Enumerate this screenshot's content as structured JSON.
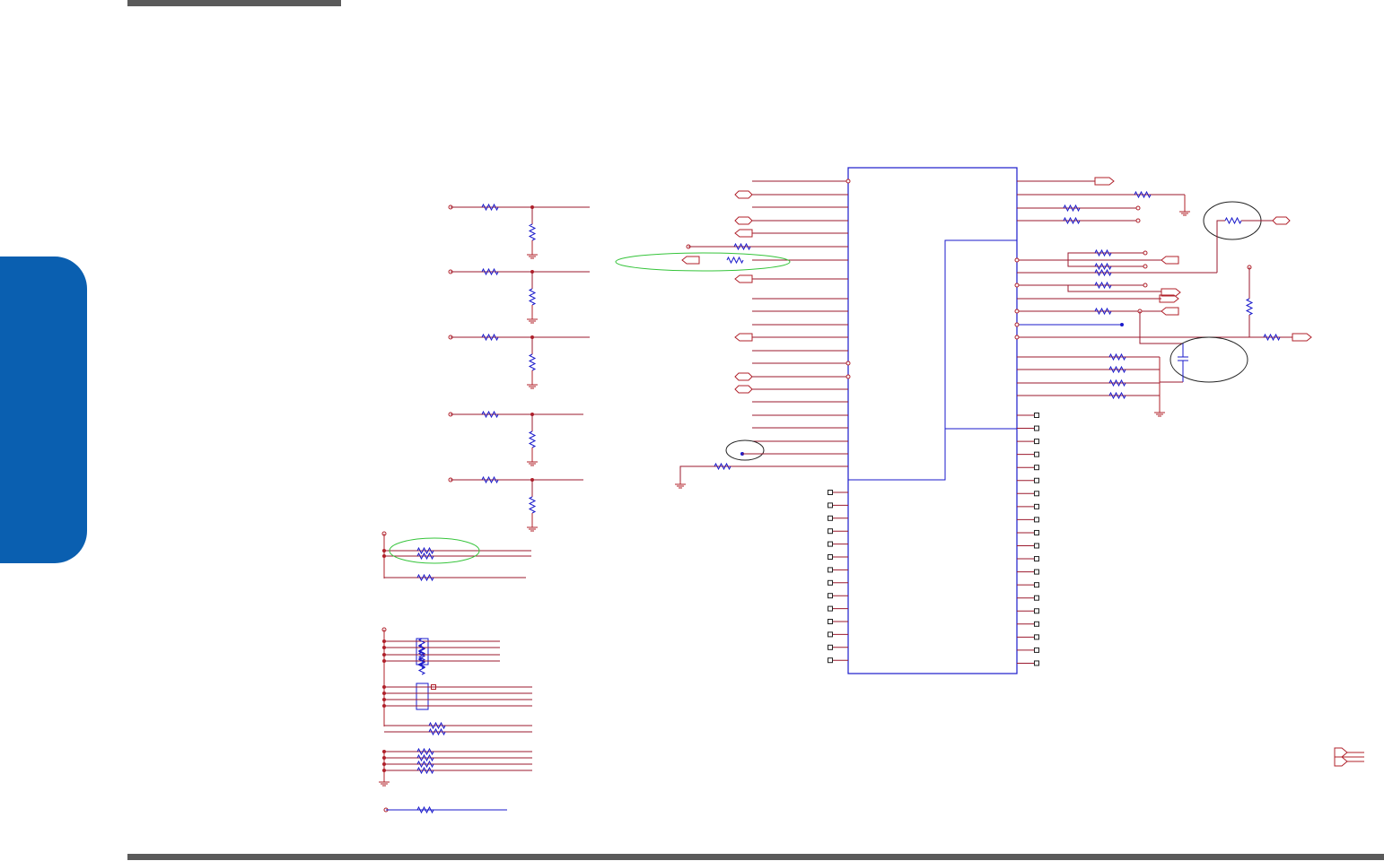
{
  "page": {
    "has_top_rule": true,
    "has_bottom_rule": true,
    "side_tab_color": "#0a5fb0"
  },
  "schematic": {
    "wire_color": "#9b1a2e",
    "component_color": "#1a1acb",
    "pin_color": "#b0202a",
    "highlight_color": "#35c43a",
    "mark_color": "#222222",
    "chip": {
      "left_pins": 23,
      "right_pins": 19,
      "bottom_left_pins": 14,
      "bottom_right_pins": 14
    }
  }
}
